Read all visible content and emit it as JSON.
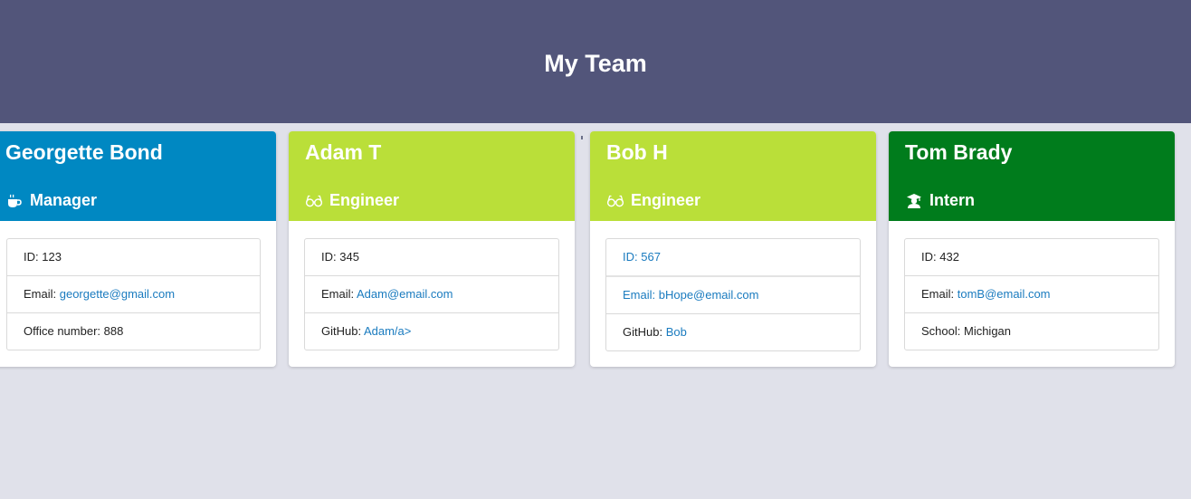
{
  "header": {
    "title": "My Team"
  },
  "colors": {
    "header_bg": "#52557a",
    "page_bg": "#e0e1ea",
    "manager": "#0088c2",
    "engineer": "#badf39",
    "intern": "#007c1c",
    "link": "#1a7bbf"
  },
  "cards": [
    {
      "name": "Georgette Bond",
      "role": "Manager",
      "role_icon": "coffee-cup-icon",
      "color": "#0088c2",
      "id_label": "ID: ",
      "id": "123",
      "email_label": "Email: ",
      "email": "georgette@gmail.com",
      "extra_label": "Office number: ",
      "extra": "888"
    },
    {
      "name": "Adam T",
      "role": "Engineer",
      "role_icon": "glasses-icon",
      "color": "#badf39",
      "id_label": "ID: ",
      "id": "345",
      "email_label": "Email: ",
      "email": "Adam@email.com",
      "extra_label": "GitHub: ",
      "extra": "Adam/a>"
    },
    {
      "name": "Bob H",
      "role": "Engineer",
      "role_icon": "glasses-icon",
      "color": "#badf39",
      "id_label": "ID: ",
      "id": "567",
      "email_label": "Email: ",
      "email": "bHope@email.com",
      "extra_label": "GitHub: ",
      "extra": "Bob"
    },
    {
      "name": "Tom Brady",
      "role": "Intern",
      "role_icon": "graduate-icon",
      "color": "#007c1c",
      "id_label": "ID: ",
      "id": "432",
      "email_label": "Email: ",
      "email": "tomB@email.com",
      "extra_label": "School: ",
      "extra": "Michigan"
    }
  ]
}
